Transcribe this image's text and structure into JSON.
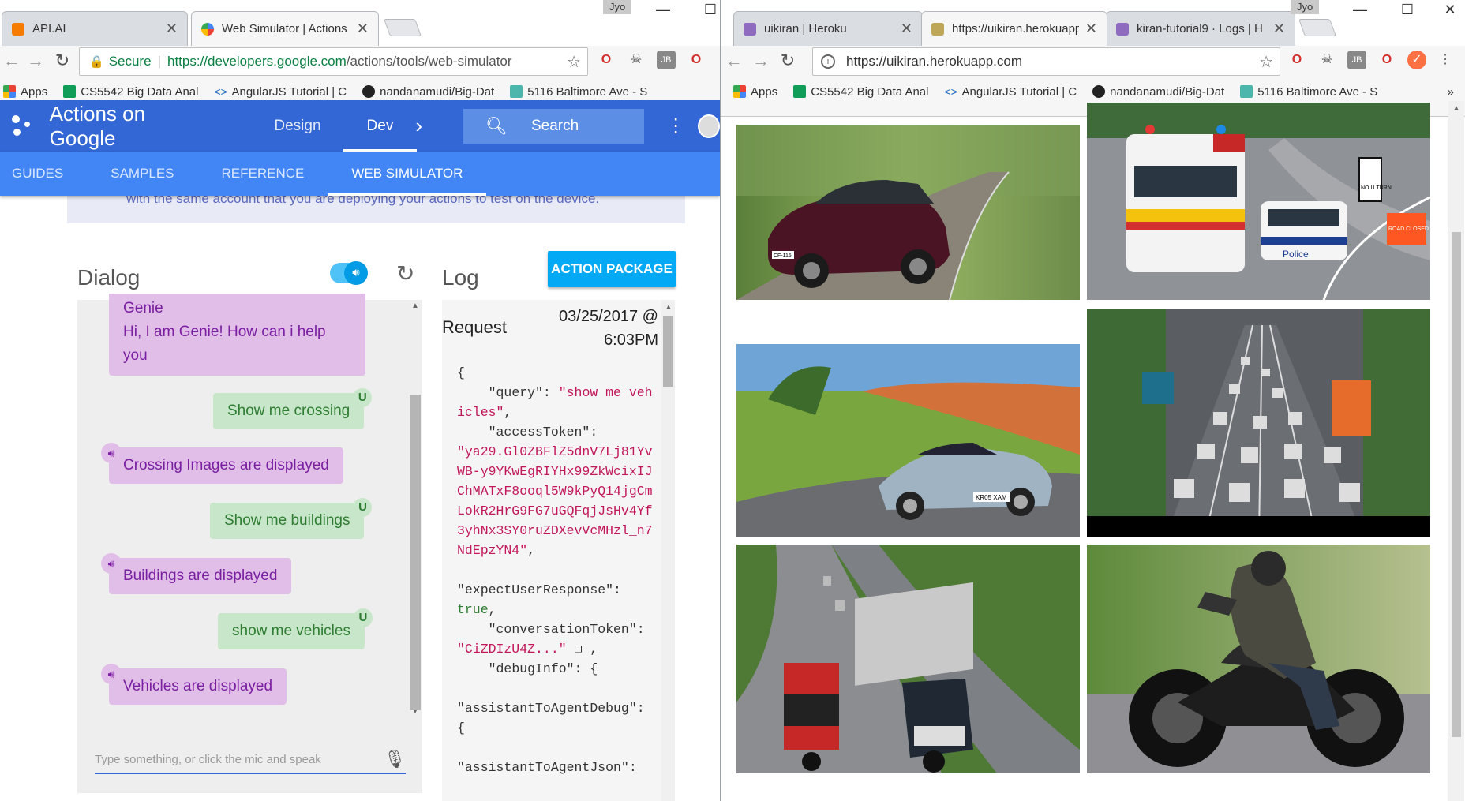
{
  "left": {
    "tabs": [
      {
        "title": "API.AI",
        "active": false
      },
      {
        "title": "Web Simulator  |  Actions",
        "active": true
      }
    ],
    "user": "Jyo",
    "address": {
      "secure_label": "Secure",
      "url_host": "https://developers.google.com",
      "url_path": "/actions/tools/web-simulator"
    },
    "bookmarks": [
      "Apps",
      "CS5542 Big Data Anal",
      "AngularJS Tutorial | C",
      "nandanamudi/Big-Dat",
      "5116 Baltimore Ave - S"
    ],
    "app_title": "Actions on Google",
    "nav": [
      "Design",
      "Dev"
    ],
    "search_label": "Search",
    "subnav": [
      "GUIDES",
      "SAMPLES",
      "REFERENCE",
      "WEB SIMULATOR"
    ],
    "banner_text": "with the same account that you are deploying your actions to test on the device.",
    "dialog_title": "Dialog",
    "log_title": "Log",
    "action_package_label": "ACTION PACKAGE",
    "messages": [
      {
        "who": "agent",
        "name": "Genie",
        "text": "Hi, I am Genie! How can i help you"
      },
      {
        "who": "user",
        "text": "Show me crossing",
        "badge": "U"
      },
      {
        "who": "agent",
        "text": "Crossing Images are displayed"
      },
      {
        "who": "user",
        "text": "Show me buildings",
        "badge": "U"
      },
      {
        "who": "agent",
        "text": "Buildings are displayed"
      },
      {
        "who": "user",
        "text": "show me vehicles",
        "badge": "U"
      },
      {
        "who": "agent",
        "text": "Vehicles are displayed"
      }
    ],
    "input_placeholder": "Type something, or click the mic and speak",
    "log": {
      "request_label": "Request",
      "date": "03/25/2017 @",
      "time": "6:03PM",
      "code_lines": [
        {
          "t": "{",
          "c": "k"
        },
        {
          "t": "    \"query\": ",
          "c": "k",
          "v": "\"show me vehicles\"",
          "vc": "s",
          "end": ","
        },
        {
          "t": "    \"accessToken\":",
          "c": "k"
        },
        {
          "t": "\"ya29.Gl0ZBFlZ5dnV7Lj81YvWB-y9YKwEgRIYHx99ZkWcixIJChMATxF8ooql5W9kPyQ14jgCmLokR2HrG9FG7uGQFqjJsHv4Yf3yhNx3SY0ruZDXevVcMHzl_n7NdEpzYN4\"",
          "c": "s",
          "end": ","
        },
        {
          "t": "",
          "c": "k"
        },
        {
          "t": "\"expectUserResponse\":",
          "c": "k"
        },
        {
          "t": "true",
          "c": "b",
          "end": ","
        },
        {
          "t": "    \"conversationToken\":",
          "c": "k"
        },
        {
          "t": "\"CiZDIzU4Z...\"",
          "c": "s",
          "end": " ❐ ,"
        },
        {
          "t": "    \"debugInfo\": {",
          "c": "k"
        },
        {
          "t": "",
          "c": "k"
        },
        {
          "t": "\"assistantToAgentDebug\":",
          "c": "k"
        },
        {
          "t": "{",
          "c": "k"
        },
        {
          "t": "",
          "c": "k"
        },
        {
          "t": "\"assistantToAgentJson\":",
          "c": "k"
        }
      ]
    }
  },
  "right": {
    "tabs": [
      {
        "title": "uikiran | Heroku",
        "active": false
      },
      {
        "title": "https://uikiran.herokuapp",
        "active": true
      },
      {
        "title": "kiran-tutorial9 · Logs | H",
        "active": false
      }
    ],
    "user": "Jyo",
    "address": {
      "url": "https://uikiran.herokuapp.com"
    },
    "bookmarks": [
      "Apps",
      "CS5542 Big Data Anal",
      "AngularJS Tutorial | C",
      "nandanamudi/Big-Dat",
      "5116 Baltimore Ave - S"
    ],
    "images": [
      {
        "name": "red-car-photo",
        "sign_text": "",
        "plate": "CF-115"
      },
      {
        "name": "emergency-vehicles-photo",
        "sign_text": "ROAD CLOSED",
        "sign2": "NO U TURN",
        "police": "Police"
      },
      {
        "name": "silver-sports-car-photo",
        "plate": "KR05 XAM"
      },
      {
        "name": "city-traffic-photo"
      },
      {
        "name": "trucks-highway-photo"
      },
      {
        "name": "motorcycle-rider-photo"
      }
    ]
  },
  "colors": {
    "aog_header": "#3367d6",
    "aog_subnav": "#4285f4",
    "agent_bubble": "#e1bee7",
    "user_bubble": "#c8e6c9",
    "action_btn": "#03a9f4"
  }
}
